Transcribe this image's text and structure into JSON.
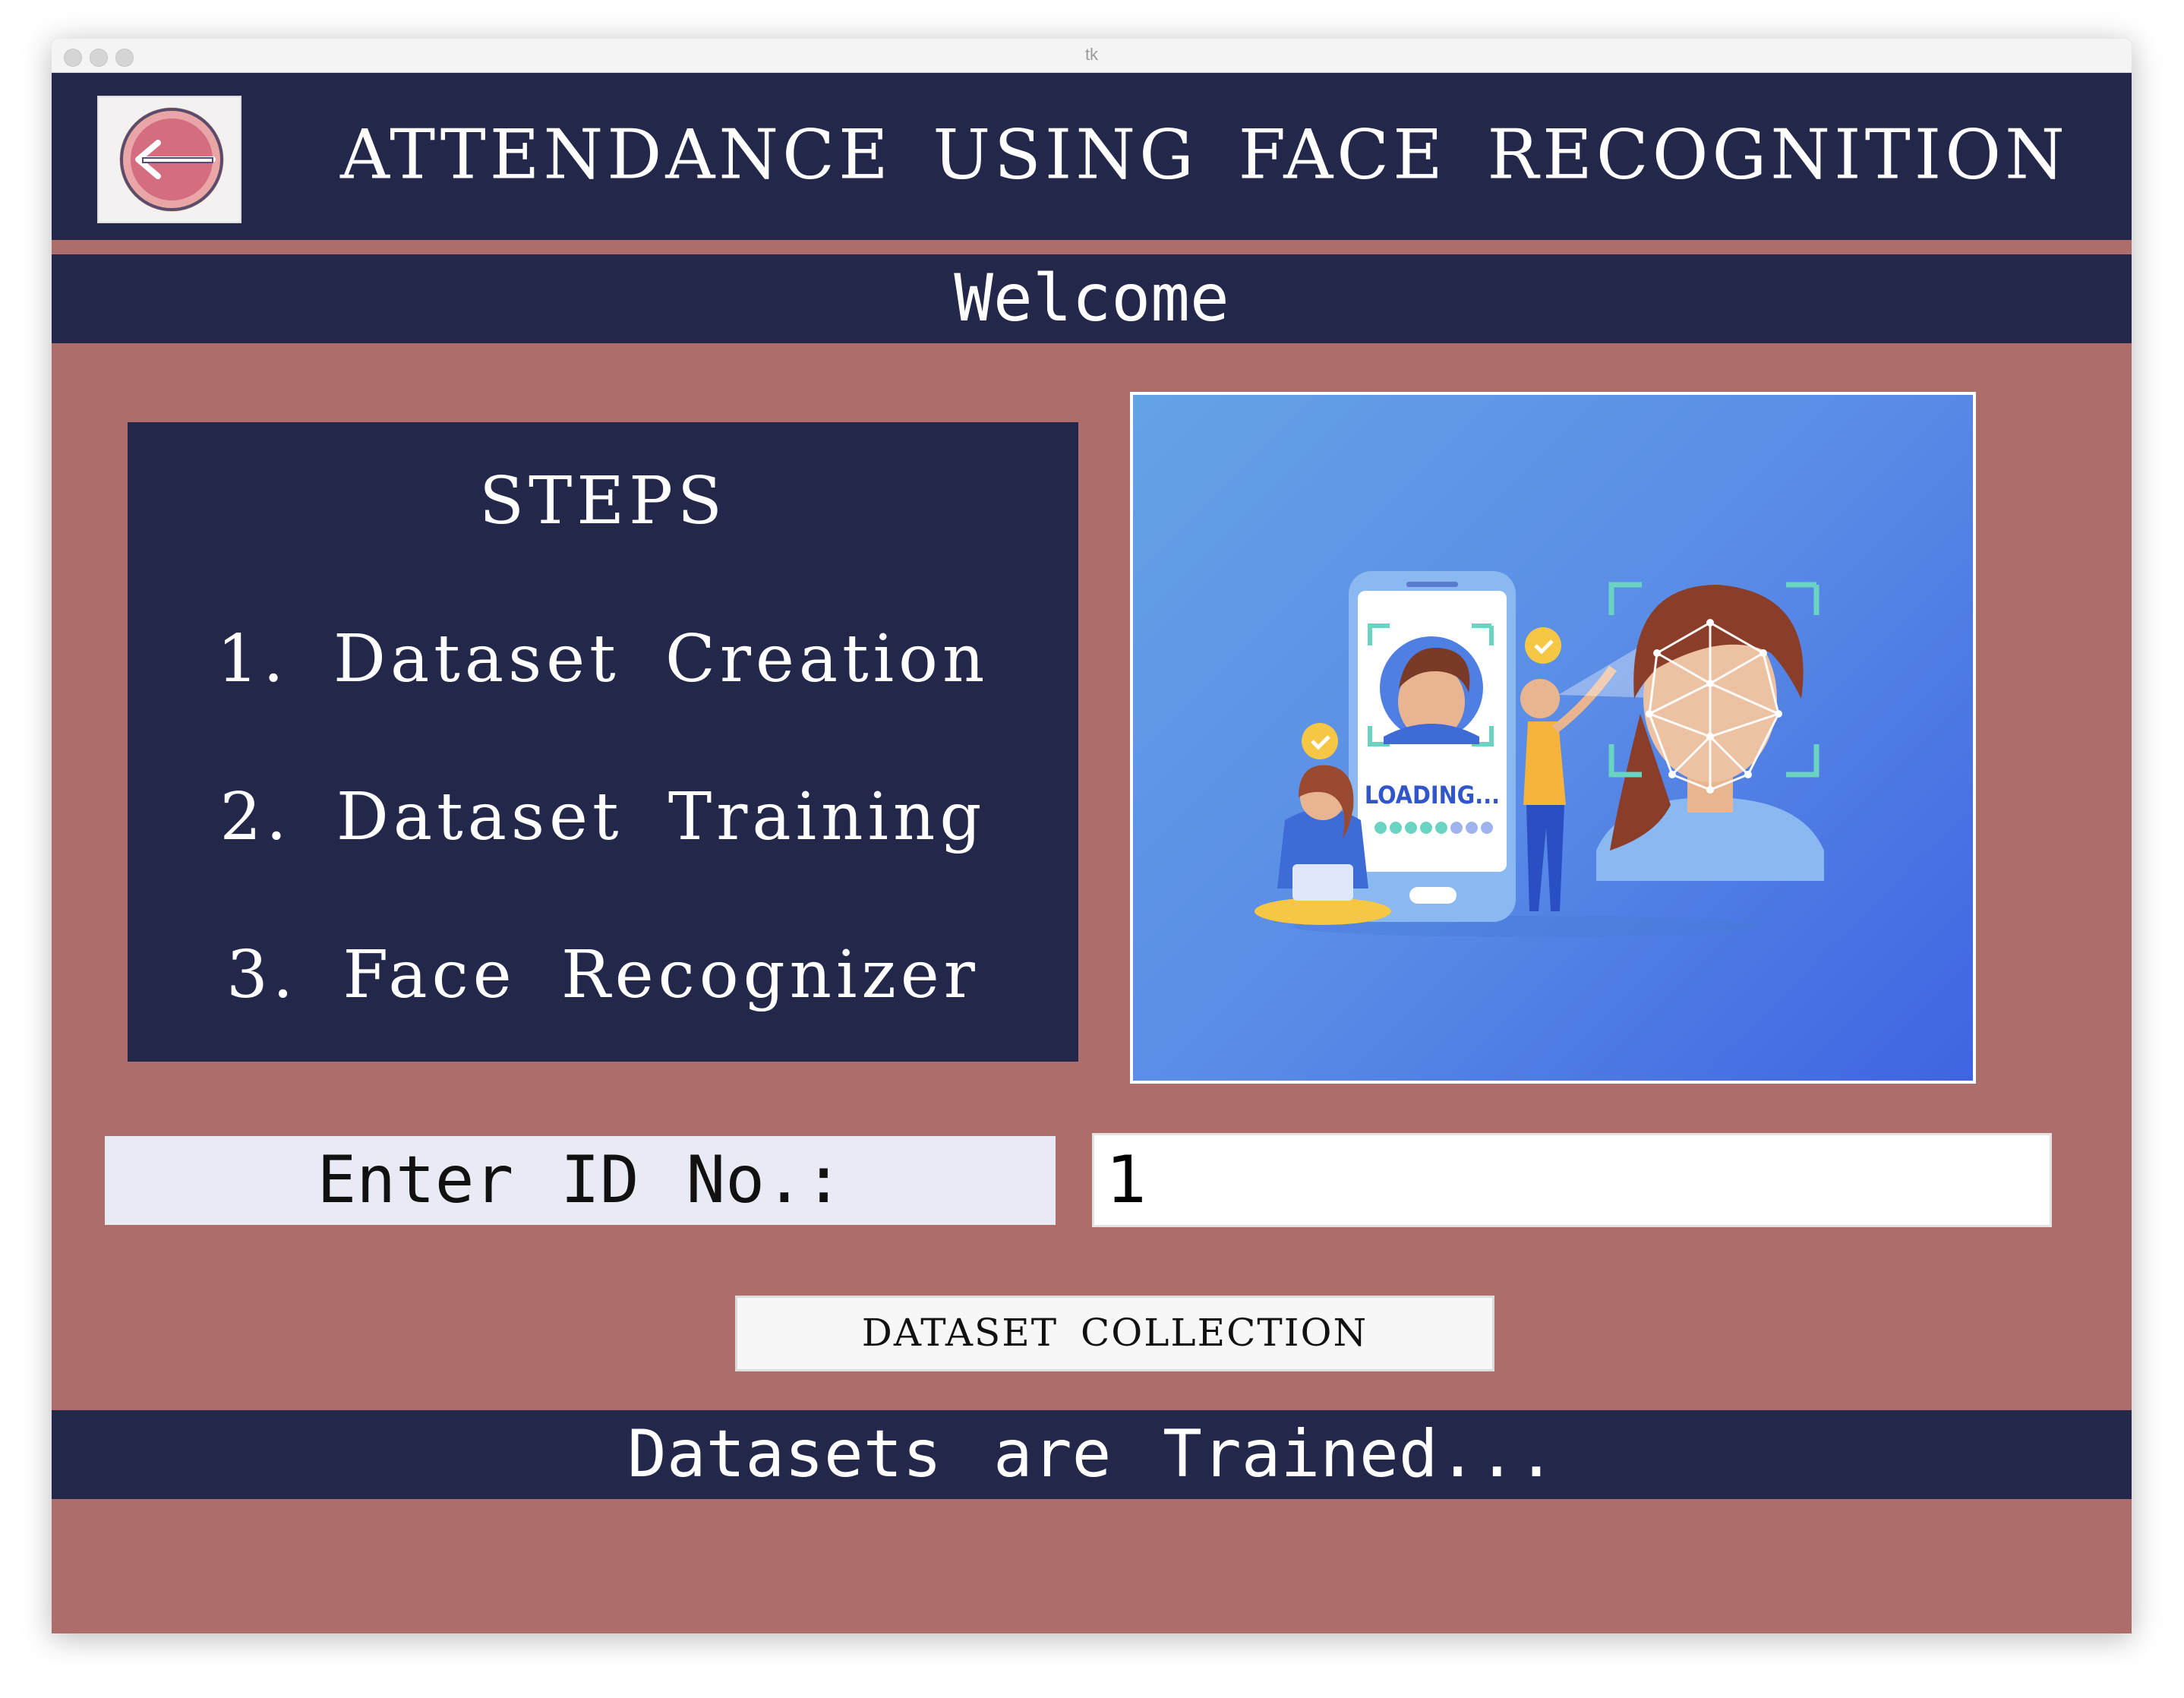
{
  "window": {
    "title": "tk"
  },
  "header": {
    "title": "ATTENDANCE USING FACE RECOGNITION",
    "logo_icon": "exit-door-icon"
  },
  "welcome": "Welcome",
  "steps": {
    "title": "STEPS",
    "items": [
      "1. Dataset Creation",
      "2. Dataset Training",
      "3. Face Recognizer"
    ]
  },
  "illustration": {
    "loading_text": "LOADING..."
  },
  "id_entry": {
    "label": "Enter ID No.:",
    "value": "1"
  },
  "buttons": {
    "dataset_collection": "DATASET COLLECTION"
  },
  "status": "Datasets are Trained...",
  "colors": {
    "navy": "#23274a",
    "rose": "#ad6d6b",
    "label_bg": "#e8ebf3"
  }
}
